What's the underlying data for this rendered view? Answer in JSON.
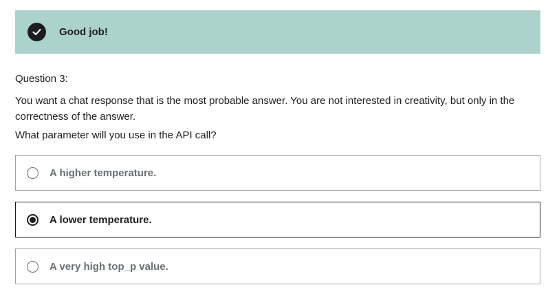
{
  "feedback": {
    "status": "correct",
    "icon": "check-circle-icon",
    "message": "Good job!",
    "color": "#acd2cc"
  },
  "question": {
    "number_label": "Question 3:",
    "text": "You want a chat response that is the most probable answer. You are not interested in creativity, but only in the correctness of the answer.",
    "prompt": "What parameter will you use in the API call?"
  },
  "options": [
    {
      "label": "A higher temperature.",
      "selected": false
    },
    {
      "label": "A lower temperature.",
      "selected": true
    },
    {
      "label": "A very high top_p value.",
      "selected": false
    }
  ]
}
